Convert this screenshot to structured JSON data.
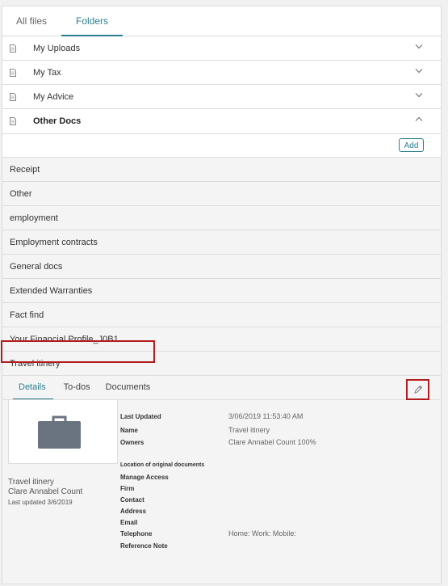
{
  "tabs": {
    "all_files": "All files",
    "folders": "Folders"
  },
  "folders": [
    {
      "label": "My Uploads",
      "expanded": false
    },
    {
      "label": "My Tax",
      "expanded": false
    },
    {
      "label": "My Advice",
      "expanded": false
    },
    {
      "label": "Other Docs",
      "expanded": true
    }
  ],
  "add_button": "Add",
  "subfolders": [
    "Receipt",
    "Other",
    "employment",
    "Employment contracts",
    "General docs",
    "Extended Warranties",
    "Fact find",
    "Your Financial Profile_J0B1",
    "Travel itinery"
  ],
  "details_tabs": {
    "details": "Details",
    "todos": "To-dos",
    "documents": "Documents"
  },
  "side": {
    "name": "Travel itinery",
    "owner": "Clare Annabel Count",
    "updated": "Last updated 3/6/2019"
  },
  "fields": {
    "last_updated_label": "Last Updated",
    "last_updated_value": "3/06/2019 11:53:40 AM",
    "name_label": "Name",
    "name_value": "Travel itinery",
    "owners_label": "Owners",
    "owners_value": "Clare Annabel Count 100%",
    "location_label": "Location of original documents",
    "manage_access_label": "Manage Access",
    "firm_label": "Firm",
    "contact_label": "Contact",
    "address_label": "Address",
    "email_label": "Email",
    "telephone_label": "Telephone",
    "telephone_value": "Home: Work: Mobile:",
    "reference_note_label": "Reference Note"
  },
  "colors": {
    "accent": "#2a7f8f",
    "highlight": "#b31c1c"
  }
}
